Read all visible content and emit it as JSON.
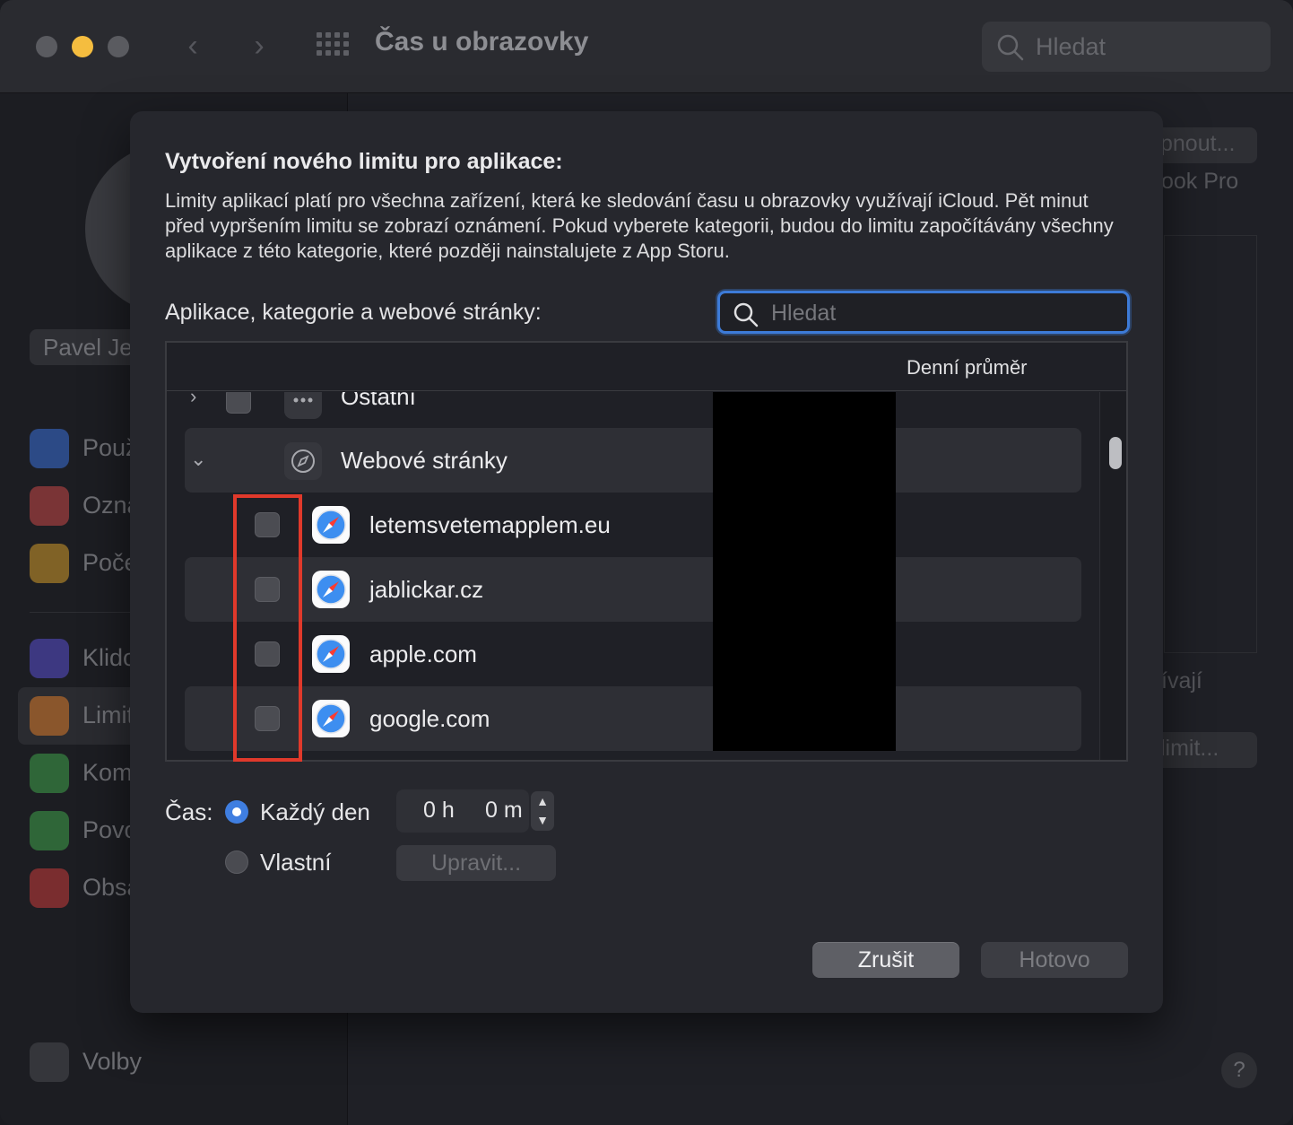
{
  "window": {
    "title": "Čas u obrazovky",
    "search_placeholder": "Hledat"
  },
  "background": {
    "user_name": "Pavel Je",
    "sidebar_items": [
      {
        "label": "Použ",
        "icon": "chart-icon",
        "color": "#3a6fd8"
      },
      {
        "label": "Ozna",
        "icon": "bell-icon",
        "color": "#c94747"
      },
      {
        "label": "Poče",
        "icon": "pickups-icon",
        "color": "#d49a2a"
      },
      {
        "label": "Klido",
        "icon": "downtime-icon",
        "color": "#5a4fd0"
      },
      {
        "label": "Limit",
        "icon": "hourglass-icon",
        "color": "#d87a2a"
      },
      {
        "label": "Kom",
        "icon": "contact-icon",
        "color": "#3fa24b"
      },
      {
        "label": "Povo",
        "icon": "checkmark-shield-icon",
        "color": "#3fa24b"
      },
      {
        "label": "Obsa",
        "icon": "restrict-icon",
        "color": "#c93a3a"
      }
    ],
    "options_label": "Volby",
    "right_fragments": [
      "pnout...",
      "ook Pro",
      "ívají",
      "limit..."
    ],
    "help": "?"
  },
  "dialog": {
    "title": "Vytvoření nového limitu pro aplikace:",
    "description": "Limity aplikací platí pro všechna zařízení, která ke sledování času u obrazovky využívají iCloud. Pět minut před vypršením limitu se zobrazí oznámení. Pokud vyberete kategorii, budou do limitu započítávány všechny aplikace z této kategorie, které později nainstalujete z App Storu.",
    "apps_label": "Aplikace, kategorie a webové stránky:",
    "search_placeholder": "Hledat",
    "column_daily_average": "Denní průměr",
    "rows": [
      {
        "label": "Ostatní",
        "type": "category",
        "expanded": false,
        "checked": false
      },
      {
        "label": "Webové stránky",
        "type": "category",
        "expanded": true
      },
      {
        "label": "letemsvetemapplem.eu",
        "type": "website",
        "checked": false
      },
      {
        "label": "jablickar.cz",
        "type": "website",
        "checked": false
      },
      {
        "label": "apple.com",
        "type": "website",
        "checked": false
      },
      {
        "label": "google.com",
        "type": "website",
        "checked": false
      }
    ],
    "time_label": "Čas:",
    "every_day_label": "Každý den",
    "custom_label": "Vlastní",
    "hours": "0 h",
    "minutes": "0 m",
    "edit_label": "Upravit...",
    "cancel_label": "Zrušit",
    "done_label": "Hotovo",
    "selected_schedule": "Každý den",
    "accent_color": "#3f7ee0",
    "highlight_color": "#e0392b"
  }
}
